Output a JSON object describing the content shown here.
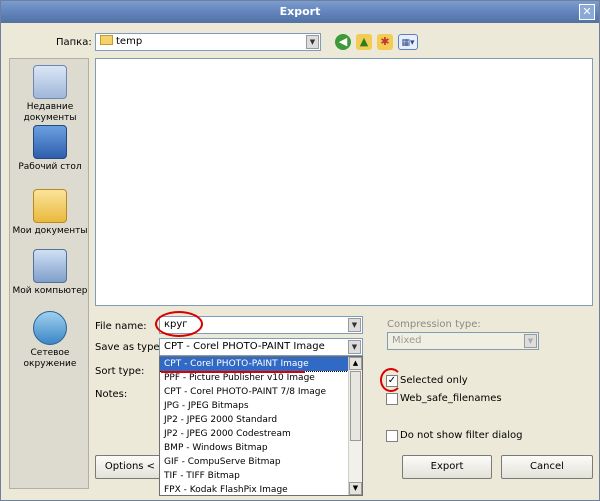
{
  "window": {
    "title": "Export",
    "close_glyph": "✕"
  },
  "lookin": {
    "label": "Папка:",
    "value": "temp"
  },
  "places": [
    {
      "label": "Недавние документы",
      "icon": "recent-documents-icon"
    },
    {
      "label": "Рабочий стол",
      "icon": "desktop-icon"
    },
    {
      "label": "Мои документы",
      "icon": "my-documents-icon"
    },
    {
      "label": "Мой компьютер",
      "icon": "my-computer-icon"
    },
    {
      "label": "Сетевое окружение",
      "icon": "network-icon"
    }
  ],
  "filename": {
    "label": "File name:",
    "value": "круг"
  },
  "savetype": {
    "label": "Save as type:",
    "value": "CPT - Corel PHOTO-PAINT Image",
    "options": [
      "CPT - Corel PHOTO-PAINT Image",
      "PPF - Picture Publisher v10 Image",
      "CPT - Corel PHOTO-PAINT 7/8 Image",
      "JPG - JPEG Bitmaps",
      "JP2 - JPEG 2000 Standard",
      "JP2 - JPEG 2000 Codestream",
      "BMP - Windows Bitmap",
      "GIF - CompuServe Bitmap",
      "TIF - TIFF Bitmap",
      "FPX - Kodak FlashPix Image"
    ],
    "selected_index": 0
  },
  "sorttype": {
    "label": "Sort type:"
  },
  "notes": {
    "label": "Notes:"
  },
  "compression": {
    "label": "Compression type:",
    "value": "Mixed"
  },
  "checks": {
    "selected_only": {
      "label": "Selected only",
      "checked": true
    },
    "web_safe": {
      "label": "Web_safe_filenames",
      "checked": false
    },
    "no_filter_dialog": {
      "label": "Do not show filter dialog",
      "checked": false
    }
  },
  "buttons": {
    "options": "Options <",
    "export": "Export",
    "cancel": "Cancel"
  },
  "colors": {
    "titlebar": "#5e80b9",
    "highlight": "#316ac5",
    "annotation": "#d90000"
  }
}
